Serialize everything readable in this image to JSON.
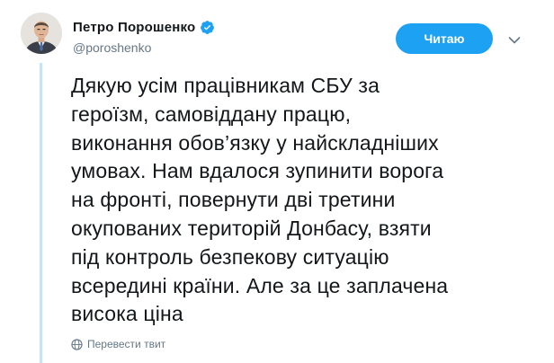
{
  "tweet": {
    "author": {
      "display_name": "Петро Порошенко",
      "username": "@poroshenko",
      "verified": true
    },
    "follow_button_label": "Читаю",
    "text_lines": [
      "Дякую усім працівникам СБУ за",
      "героїзм, самовіддану працю,",
      "виконання обов’язку у найскладніших",
      "умовах. Нам вдалося зупинити ворога",
      "на фронті, повернути дві третини",
      "окупованих територій Донбасу, взяти",
      "під контроль безпекову ситуацію",
      "всередині країни. Але за це заплачена",
      "висока ціна"
    ],
    "translate_label": "Перевести твит"
  },
  "colors": {
    "accent": "#1da1f2",
    "thread_line": "#c7e3f4",
    "secondary_text": "#657786",
    "primary_text": "#14171a"
  },
  "icons": {
    "verified": "verified-badge-icon",
    "more": "chevron-down-icon",
    "translate": "globe-icon"
  }
}
